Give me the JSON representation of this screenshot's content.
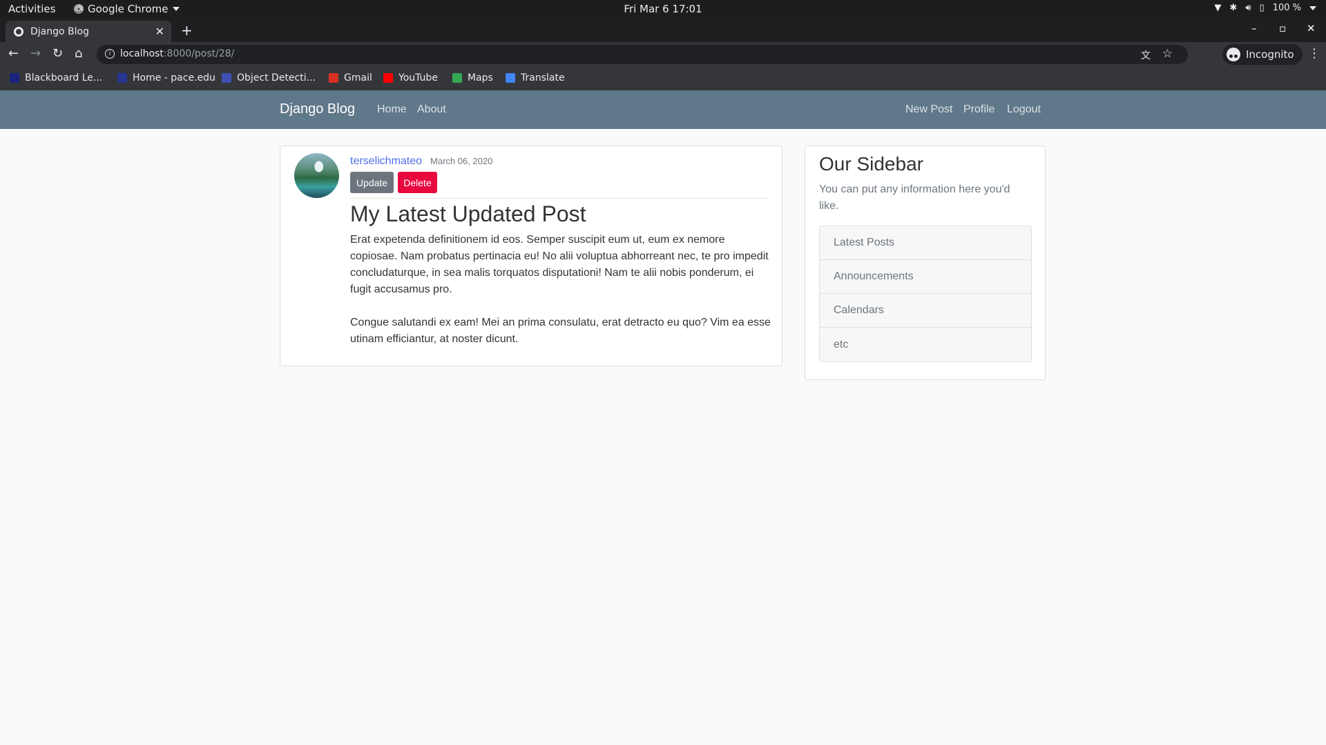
{
  "system_bar": {
    "activities": "Activities",
    "app_name": "Google Chrome",
    "clock": "Fri Mar 6  17:01",
    "battery": "100 %"
  },
  "browser": {
    "tab_title": "Django Blog",
    "new_tab": "+",
    "url_host": "localhost",
    "url_path": ":8000/post/28/",
    "profile_label": "Incognito",
    "bookmarks": [
      {
        "label": "Blackboard Le...",
        "color": "#1a237e"
      },
      {
        "label": "Home - pace.edu",
        "color": "#283593"
      },
      {
        "label": "Object Detecti...",
        "color": "#3f51b5"
      },
      {
        "label": "Gmail",
        "color": "#d93025"
      },
      {
        "label": "YouTube",
        "color": "#ff0000"
      },
      {
        "label": "Maps",
        "color": "#34a853"
      },
      {
        "label": "Translate",
        "color": "#4285f4"
      }
    ]
  },
  "site_nav": {
    "brand": "Django Blog",
    "left_links": [
      "Home",
      "About"
    ],
    "right_links": [
      "New Post",
      "Profile",
      "Logout"
    ]
  },
  "post": {
    "author": "terselichmateo",
    "date": "March 06, 2020",
    "update_label": "Update",
    "delete_label": "Delete",
    "title": "My Latest Updated Post",
    "paragraphs": [
      "Erat expetenda definitionem id eos. Semper suscipit eum ut, eum ex nemore copiosae. Nam probatus pertinacia eu! No alii voluptua abhorreant nec, te pro impedit concludaturque, in sea malis torquatos disputationi! Nam te alii nobis ponderum, ei fugit accusamus pro.",
      "Congue salutandi ex eam! Mei an prima consulatu, erat detracto eu quo? Vim ea esse utinam efficiantur, at noster dicunt."
    ]
  },
  "sidebar": {
    "title": "Our Sidebar",
    "description": "You can put any information here you'd like.",
    "items": [
      "Latest Posts",
      "Announcements",
      "Calendars",
      "etc"
    ]
  },
  "colors": {
    "navbar_bg": "#5f788a",
    "author_link": "#4d6ee8",
    "update_btn": "#6c757d",
    "delete_btn": "#e8083e"
  }
}
